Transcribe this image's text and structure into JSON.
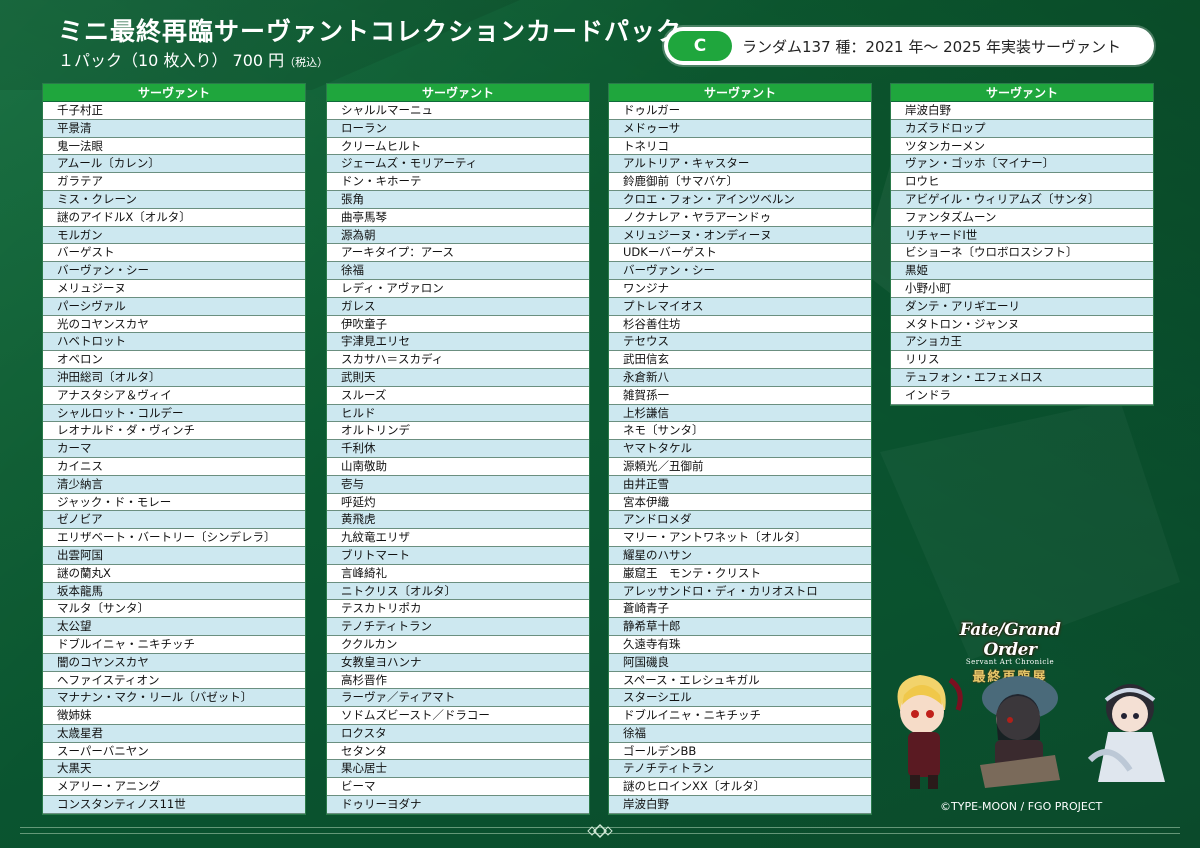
{
  "header": {
    "title": "ミニ最終再臨サーヴァントコレクションカードパック",
    "subtitle_main": "１パック（10 枚入り） 700 円",
    "subtitle_tax": "（税込）"
  },
  "badge": {
    "letter": "C",
    "text": "ランダム137 種：2021 年〜 2025 年実装サーヴァント"
  },
  "columns": [
    {
      "header": "サーヴァント",
      "items": [
        "千子村正",
        "平景清",
        "鬼一法眼",
        "アムール〔カレン〕",
        "ガラテア",
        "ミス・クレーン",
        "謎のアイドルX〔オルタ〕",
        "モルガン",
        "バーゲスト",
        "バーヴァン・シー",
        "メリュジーヌ",
        "パーシヴァル",
        "光のコヤンスカヤ",
        "ハベトロット",
        "オベロン",
        "沖田総司〔オルタ〕",
        "アナスタシア＆ヴィイ",
        "シャルロット・コルデー",
        "レオナルド・ダ・ヴィンチ",
        "カーマ",
        "カイニス",
        "清少納言",
        "ジャック・ド・モレー",
        "ゼノビア",
        "エリザベート・バートリー〔シンデレラ〕",
        "出雲阿国",
        "謎の蘭丸X",
        "坂本龍馬",
        "マルタ〔サンタ〕",
        "太公望",
        "ドブルイニャ・ニキチッチ",
        "闇のコヤンスカヤ",
        "ヘファイスティオン",
        "マナナン・マク・リール〔バゼット〕",
        "徴姉妹",
        "太歳星君",
        "スーパーバニヤン",
        "大黒天",
        "メアリー・アニング",
        "コンスタンティノス11世"
      ]
    },
    {
      "header": "サーヴァント",
      "items": [
        "シャルルマーニュ",
        "ローラン",
        "クリームヒルト",
        "ジェームズ・モリアーティ",
        "ドン・キホーテ",
        "張角",
        "曲亭馬琴",
        "源為朝",
        "アーキタイプ：アース",
        "徐福",
        "レディ・アヴァロン",
        "ガレス",
        "伊吹童子",
        "宇津見エリセ",
        "スカサハ＝スカディ",
        "武則天",
        "スルーズ",
        "ヒルド",
        "オルトリンデ",
        "千利休",
        "山南敬助",
        "壱与",
        "呼延灼",
        "黄飛虎",
        "九紋竜エリザ",
        "ブリトマート",
        "言峰綺礼",
        "ニトクリス〔オルタ〕",
        "テスカトリポカ",
        "テノチティトラン",
        "ククルカン",
        "女教皇ヨハンナ",
        "高杉晋作",
        "ラーヴァ／ティアマト",
        "ソドムズビースト／ドラコー",
        "ロクスタ",
        "セタンタ",
        "果心居士",
        "ビーマ",
        "ドゥリーヨダナ"
      ]
    },
    {
      "header": "サーヴァント",
      "items": [
        "ドゥルガー",
        "メドゥーサ",
        "トネリコ",
        "アルトリア・キャスター",
        "鈴鹿御前〔サマバケ〕",
        "クロエ・フォン・アインツベルン",
        "ノクナレア・ヤラアーンドゥ",
        "メリュジーヌ・オンディーヌ",
        "UDKーバーゲスト",
        "バーヴァン・シー",
        "ワンジナ",
        "プトレマイオス",
        "杉谷善住坊",
        "テセウス",
        "武田信玄",
        "永倉新八",
        "雑賀孫一",
        "上杉謙信",
        "ネモ〔サンタ〕",
        "ヤマトタケル",
        "源頼光／丑御前",
        "由井正雪",
        "宮本伊織",
        "アンドロメダ",
        "マリー・アントワネット〔オルタ〕",
        "耀星のハサン",
        "巌窟王　モンテ・クリスト",
        "アレッサンドロ・ディ・カリオストロ",
        "蒼崎青子",
        "静希草十郎",
        "久遠寺有珠",
        "阿国磯良",
        "スペース・エレシュキガル",
        "スターシエル",
        "ドブルイニャ・ニキチッチ",
        "徐福",
        "ゴールデンBB",
        "テノチティトラン",
        "謎のヒロインXX〔オルタ〕",
        "岸波白野"
      ]
    },
    {
      "header": "サーヴァント",
      "items": [
        "岸波白野",
        "カズラドロップ",
        "ツタンカーメン",
        "ヴァン・ゴッホ〔マイナー〕",
        "ロウヒ",
        "アビゲイル・ウィリアムズ〔サンタ〕",
        "ファンタズムーン",
        "リチャードⅠ世",
        "ビショーネ〔ウロボロスシフト〕",
        "黒姫",
        "小野小町",
        "ダンテ・アリギエーリ",
        "メタトロン・ジャンヌ",
        "アショカ王",
        "リリス",
        "テュフォン・エフェメロス",
        "インドラ"
      ]
    }
  ],
  "logo": {
    "line1": "Fate/Grand Order",
    "line2": "Servant Art Chronicle",
    "line3": "最終再臨展"
  },
  "copyright": "©TYPE-MOON / FGO PROJECT",
  "colors": {
    "accent_green": "#1fa63d",
    "background_green": "#0c5c31",
    "row_blue": "#cde8f0"
  }
}
